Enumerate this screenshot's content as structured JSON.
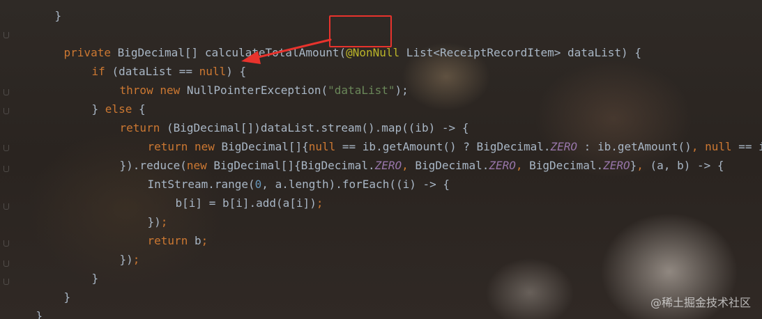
{
  "code": {
    "line0": "}",
    "line1": {
      "mod": "private ",
      "type": "BigDecimal[] calculateTotalAmount(",
      "ann": "@NonNull",
      "params": " List<ReceiptRecordItem> dataList) {"
    },
    "line2": {
      "kw": "if ",
      "rest": "(dataList == ",
      "nul": "null",
      "end": ") {"
    },
    "line3": {
      "kw1": "throw ",
      "kw2": "new ",
      "cls": "NullPointerException(",
      "str": "\"dataList\"",
      "end": ");"
    },
    "line4": {
      "pre": "} ",
      "kw": "else ",
      "end": "{"
    },
    "line5": {
      "kw": "return ",
      "rest": "(BigDecimal[])dataList.stream().map((ib) -> {"
    },
    "line6": {
      "kw1": "return ",
      "kw2": "new ",
      "cls": "BigDecimal[]{",
      "nul1": "null",
      "mid1": " == ib.getAmount() ? BigDecimal.",
      "fld": "ZERO",
      "mid2": " : ib.getAmount()",
      "comma": ", ",
      "nul2": "null",
      "tail": " == i"
    },
    "line7": {
      "pre": "}).reduce(",
      "kw": "new ",
      "a": "BigDecimal[]{BigDecimal.",
      "f1": "ZERO",
      "c1": ", ",
      "b": "BigDecimal.",
      "f2": "ZERO",
      "c2": ", ",
      "c": "BigDecimal.",
      "f3": "ZERO",
      "d": "}",
      "c3": ", ",
      "e": "(a, b) -> {"
    },
    "line8": {
      "a": "IntStream.range(",
      "num": "0",
      "b": ", a.length).forEach((i) -> {"
    },
    "line9": {
      "a": "b[i] = b[i].add(a[i])",
      "sm": ";"
    },
    "line10": {
      "a": "})",
      "sm": ";"
    },
    "line11": {
      "kw": "return ",
      "a": "b",
      "sm": ";"
    },
    "line12": {
      "a": "})",
      "sm": ";"
    },
    "line13": "}",
    "line14": "}",
    "line15": "}"
  },
  "annotation": {
    "box_color": "#e8332d",
    "arrow_color": "#e8332d"
  },
  "watermark": "@稀土掘金技术社区",
  "colors": {
    "keyword": "#cc7832",
    "string": "#6a8759",
    "annotation": "#bbb529",
    "number": "#6897bb",
    "field": "#9876aa",
    "text": "#a9b7c6"
  }
}
